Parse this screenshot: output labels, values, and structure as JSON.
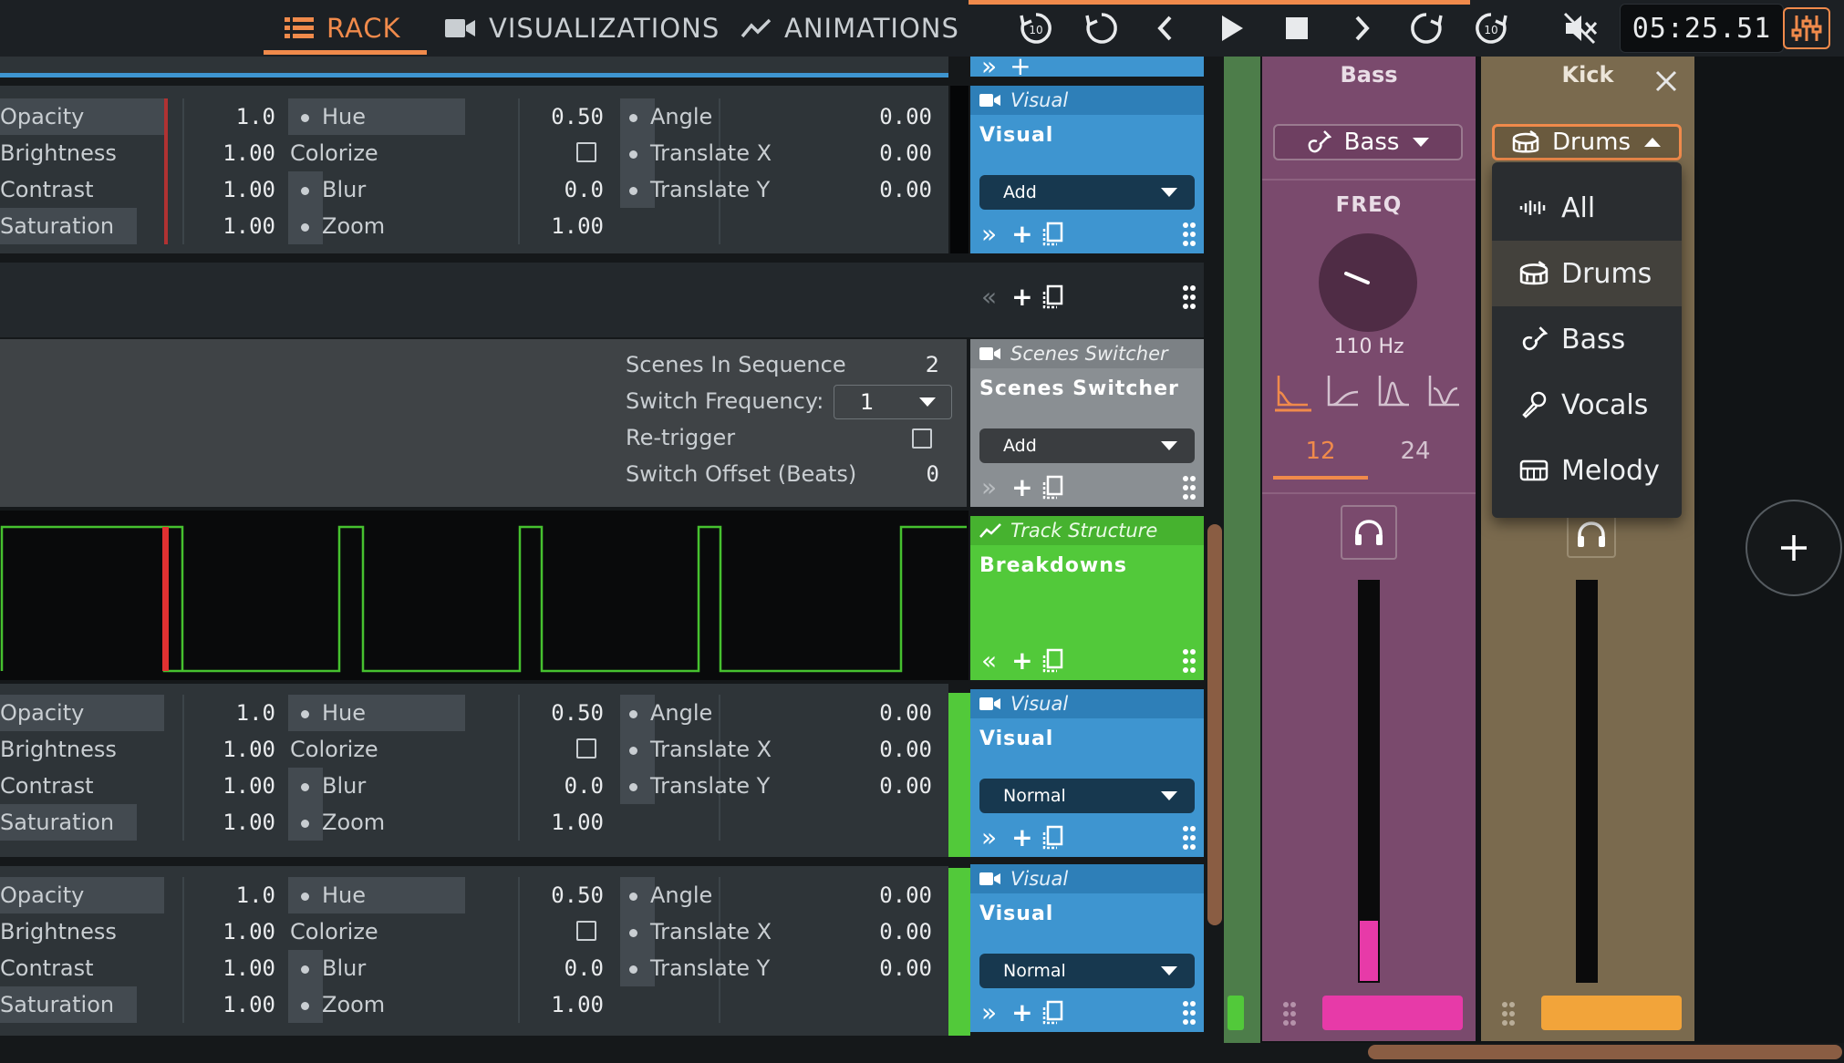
{
  "toolbar": {
    "tabs": [
      {
        "label": "RACK",
        "icon": "list-icon",
        "active": true
      },
      {
        "label": "VISUALIZATIONS",
        "icon": "camera-icon",
        "active": false
      },
      {
        "label": "ANIMATIONS",
        "icon": "trend-icon",
        "active": false
      }
    ],
    "rewind_label": "10",
    "forward_label": "10",
    "clock": "05:25.51",
    "accent": "#f08a4b"
  },
  "visual_params": {
    "opacity": {
      "label": "Opacity",
      "value": "1.0"
    },
    "brightness": {
      "label": "Brightness",
      "value": "1.00"
    },
    "contrast": {
      "label": "Contrast",
      "value": "1.00"
    },
    "saturation": {
      "label": "Saturation",
      "value": "1.00"
    },
    "hue": {
      "label": "Hue",
      "value": "0.50"
    },
    "colorize": {
      "label": "Colorize"
    },
    "blur": {
      "label": "Blur",
      "value": "0.0"
    },
    "zoom": {
      "label": "Zoom",
      "value": "1.00"
    },
    "angle": {
      "label": "Angle",
      "value": "0.00"
    },
    "translate_x": {
      "label": "Translate X",
      "value": "0.00"
    },
    "translate_y": {
      "label": "Translate Y",
      "value": "0.00"
    }
  },
  "cards": {
    "visual1": {
      "type": "Visual",
      "title": "Visual",
      "blend": "Add",
      "color": "#3e95d0"
    },
    "scenes": {
      "type": "Scenes Switcher",
      "title": "Scenes Switcher",
      "blend": "Add",
      "color": "#8a8f93"
    },
    "track": {
      "type": "Track Structure",
      "title": "Breakdowns",
      "color": "#52c93a"
    },
    "visual2": {
      "type": "Visual",
      "title": "Visual",
      "blend": "Normal",
      "color": "#3e95d0"
    },
    "visual3": {
      "type": "Visual",
      "title": "Visual",
      "blend": "Normal",
      "color": "#3e95d0"
    }
  },
  "scenes": {
    "in_sequence_label": "Scenes In Sequence",
    "in_sequence_value": "2",
    "switch_freq_label": "Switch Frequency:",
    "switch_freq_value": "1",
    "retrigger_label": "Re-trigger",
    "offset_label": "Switch Offset (Beats)",
    "offset_value": "0"
  },
  "mixer": {
    "bass": {
      "name": "Bass",
      "source": "Bass",
      "freq_label": "FREQ",
      "freq_value": "110 Hz",
      "slopes": [
        "12",
        "24"
      ],
      "selected_slope": "12",
      "level": 0.15,
      "color": "#e73aa8",
      "bg": "#7a4a6d"
    },
    "kick": {
      "name": "Kick",
      "source": "Drums",
      "level": 0.0,
      "color": "#f2a43a",
      "bg": "#7a6a4e"
    },
    "dropdown_options": [
      {
        "label": "All",
        "icon": "waveform-icon"
      },
      {
        "label": "Drums",
        "icon": "drum-icon",
        "selected": true
      },
      {
        "label": "Bass",
        "icon": "guitar-icon"
      },
      {
        "label": "Vocals",
        "icon": "microphone-icon"
      },
      {
        "label": "Melody",
        "icon": "keyboard-icon"
      }
    ]
  }
}
